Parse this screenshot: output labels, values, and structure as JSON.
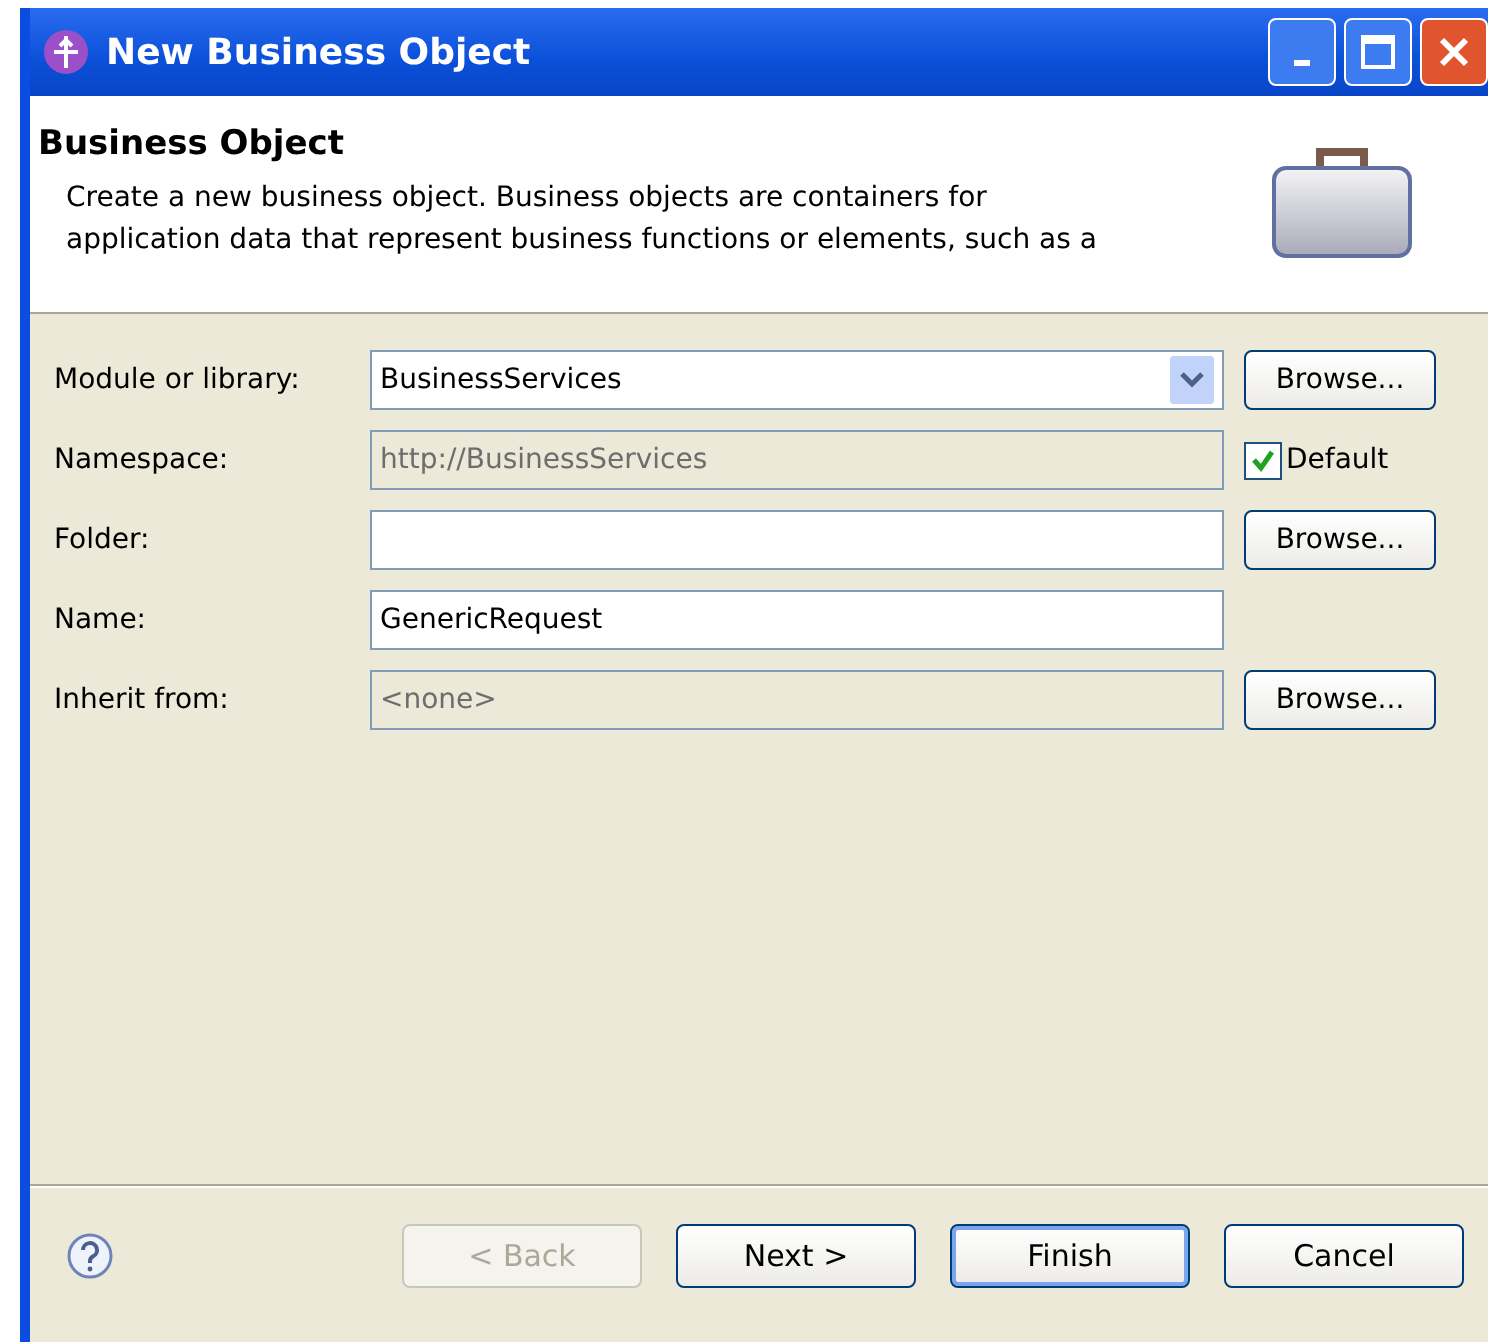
{
  "window": {
    "title": "New Business Object"
  },
  "header": {
    "title": "Business Object",
    "description": "Create a new business object. Business objects are containers for\napplication data that represent business functions or elements, such as a"
  },
  "fields": [
    {
      "label": "Module or library:",
      "kind": "combo",
      "value": "BusinessServices",
      "disabled": false,
      "side": {
        "kind": "button",
        "label": "Browse..."
      }
    },
    {
      "label": "Namespace:",
      "kind": "text",
      "value": "http://BusinessServices",
      "disabled": true,
      "side": {
        "kind": "checkbox",
        "label": "Default",
        "checked": true
      }
    },
    {
      "label": "Folder:",
      "kind": "text",
      "disabled": false,
      "side": {
        "kind": "button",
        "label": "Browse..."
      }
    },
    {
      "label": "Name:",
      "kind": "text",
      "value": "GenericRequest",
      "disabled": false
    },
    {
      "label": "Inherit from:",
      "kind": "text",
      "value": "<none>",
      "disabled": true,
      "side": {
        "kind": "button",
        "label": "Browse..."
      }
    }
  ],
  "buttons": [
    {
      "label": "< Back",
      "disabled": true,
      "default": false
    },
    {
      "label": "Next >",
      "disabled": false,
      "default": false
    },
    {
      "label": "Finish",
      "disabled": false,
      "default": true
    },
    {
      "label": "Cancel",
      "disabled": false,
      "default": false
    }
  ]
}
